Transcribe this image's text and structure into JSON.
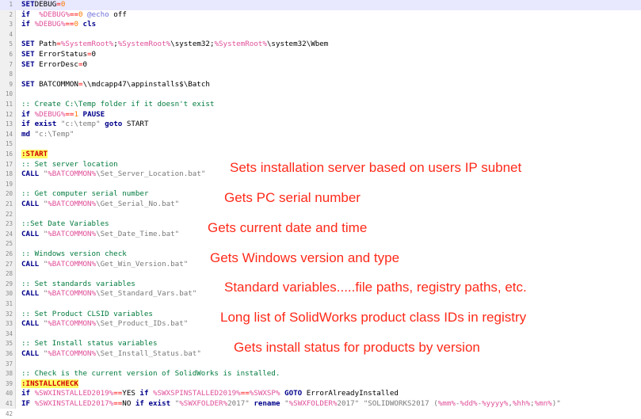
{
  "colors": {
    "keyword": "#00008b",
    "variable": "#e0509a",
    "operator": "#ff0000",
    "string": "#7a7a7a",
    "comment": "#007a3d",
    "number": "#ff7a00",
    "label_bg": "#ffff66",
    "annotation": "#ff2a1a"
  },
  "lines": [
    {
      "n": "1",
      "segs": [
        [
          "kw",
          "SET"
        ],
        [
          "",
          "DEBUG"
        ],
        [
          "op",
          "="
        ],
        [
          "num",
          "0"
        ]
      ]
    },
    {
      "n": "2",
      "segs": [
        [
          "kw",
          "if"
        ],
        [
          "",
          "  "
        ],
        [
          "var",
          "%DEBUG%"
        ],
        [
          "op",
          "=="
        ],
        [
          "num",
          "0"
        ],
        [
          "",
          ""
        ],
        [
          "cmd",
          " @echo"
        ],
        [
          "",
          " off"
        ]
      ]
    },
    {
      "n": "3",
      "segs": [
        [
          "kw",
          "if"
        ],
        [
          "",
          " "
        ],
        [
          "var",
          "%DEBUG%"
        ],
        [
          "op",
          "=="
        ],
        [
          "num",
          "0"
        ],
        [
          "",
          " "
        ],
        [
          "kw",
          "cls"
        ]
      ]
    },
    {
      "n": "4",
      "segs": []
    },
    {
      "n": "5",
      "segs": [
        [
          "kw",
          "SET"
        ],
        [
          "",
          " Path"
        ],
        [
          "op",
          "="
        ],
        [
          "var",
          "%SystemRoot%"
        ],
        [
          "",
          ";"
        ],
        [
          "var",
          "%SystemRoot%"
        ],
        [
          "",
          "\\system32;"
        ],
        [
          "var",
          "%SystemRoot%"
        ],
        [
          "",
          "\\system32\\Wbem"
        ]
      ]
    },
    {
      "n": "6",
      "segs": [
        [
          "kw",
          "SET"
        ],
        [
          "",
          " ErrorStatus"
        ],
        [
          "op",
          "="
        ],
        [
          "",
          "0"
        ]
      ]
    },
    {
      "n": "7",
      "segs": [
        [
          "kw",
          "SET"
        ],
        [
          "",
          " ErrorDesc"
        ],
        [
          "op",
          "="
        ],
        [
          "",
          "0"
        ]
      ]
    },
    {
      "n": "8",
      "segs": []
    },
    {
      "n": "9",
      "segs": [
        [
          "kw",
          "SET"
        ],
        [
          "",
          " BATCOMMON"
        ],
        [
          "op",
          "="
        ],
        [
          "",
          "\\\\mdcapp47\\appinstalls$\\Batch"
        ]
      ]
    },
    {
      "n": "10",
      "segs": []
    },
    {
      "n": "11",
      "segs": [
        [
          "cmt",
          ":: Create C:\\Temp folder if it doesn't exist"
        ]
      ]
    },
    {
      "n": "12",
      "segs": [
        [
          "kw",
          "if"
        ],
        [
          "",
          " "
        ],
        [
          "var",
          "%DEBUG%"
        ],
        [
          "op",
          "=="
        ],
        [
          "num",
          "1"
        ],
        [
          "",
          " "
        ],
        [
          "kw",
          "PAUSE"
        ]
      ]
    },
    {
      "n": "13",
      "segs": [
        [
          "kw",
          "if exist"
        ],
        [
          "",
          " "
        ],
        [
          "str",
          "\"c:\\temp\""
        ],
        [
          "",
          " "
        ],
        [
          "kw",
          "goto"
        ],
        [
          "",
          " START"
        ]
      ]
    },
    {
      "n": "14",
      "segs": [
        [
          "kw",
          "md"
        ],
        [
          "",
          " "
        ],
        [
          "str",
          "\"c:\\Temp\""
        ]
      ]
    },
    {
      "n": "15",
      "segs": []
    },
    {
      "n": "16",
      "segs": [
        [
          "lbl",
          ":START"
        ]
      ]
    },
    {
      "n": "17",
      "segs": [
        [
          "cmt",
          ":: Set server location"
        ]
      ]
    },
    {
      "n": "18",
      "segs": [
        [
          "kw",
          "CALL"
        ],
        [
          "",
          " "
        ],
        [
          "str",
          "\""
        ],
        [
          "var",
          "%BATCOMMON%"
        ],
        [
          "str",
          "\\Set_Server_Location.bat\""
        ]
      ]
    },
    {
      "n": "19",
      "segs": []
    },
    {
      "n": "20",
      "segs": [
        [
          "cmt",
          ":: Get computer serial number"
        ]
      ]
    },
    {
      "n": "21",
      "segs": [
        [
          "kw",
          "CALL"
        ],
        [
          "",
          " "
        ],
        [
          "str",
          "\""
        ],
        [
          "var",
          "%BATCOMMON%"
        ],
        [
          "str",
          "\\Get_Serial_No.bat\""
        ]
      ]
    },
    {
      "n": "22",
      "segs": []
    },
    {
      "n": "23",
      "segs": [
        [
          "cmt",
          "::Set Date Variables"
        ]
      ]
    },
    {
      "n": "24",
      "segs": [
        [
          "kw",
          "CALL"
        ],
        [
          "",
          " "
        ],
        [
          "str",
          "\""
        ],
        [
          "var",
          "%BATCOMMON%"
        ],
        [
          "str",
          "\\Set_Date_Time.bat\""
        ]
      ]
    },
    {
      "n": "25",
      "segs": []
    },
    {
      "n": "26",
      "segs": [
        [
          "cmt",
          ":: Windows version check"
        ]
      ]
    },
    {
      "n": "27",
      "segs": [
        [
          "kw",
          "CALL"
        ],
        [
          "",
          " "
        ],
        [
          "str",
          "\""
        ],
        [
          "var",
          "%BATCOMMON%"
        ],
        [
          "str",
          "\\Get_Win_Version.bat\""
        ]
      ]
    },
    {
      "n": "28",
      "segs": []
    },
    {
      "n": "29",
      "segs": [
        [
          "cmt",
          ":: Set standards variables"
        ]
      ]
    },
    {
      "n": "30",
      "segs": [
        [
          "kw",
          "CALL"
        ],
        [
          "",
          " "
        ],
        [
          "str",
          "\""
        ],
        [
          "var",
          "%BATCOMMON%"
        ],
        [
          "str",
          "\\Set_Standard_Vars.bat\""
        ]
      ]
    },
    {
      "n": "31",
      "segs": []
    },
    {
      "n": "32",
      "segs": [
        [
          "cmt",
          ":: Set Product CLSID variables"
        ]
      ]
    },
    {
      "n": "33",
      "segs": [
        [
          "kw",
          "CALL"
        ],
        [
          "",
          " "
        ],
        [
          "str",
          "\""
        ],
        [
          "var",
          "%BATCOMMON%"
        ],
        [
          "str",
          "\\Set_Product_IDs.bat\""
        ]
      ]
    },
    {
      "n": "34",
      "segs": []
    },
    {
      "n": "35",
      "segs": [
        [
          "cmt",
          ":: Set Install status variables"
        ]
      ]
    },
    {
      "n": "36",
      "segs": [
        [
          "kw",
          "CALL"
        ],
        [
          "",
          " "
        ],
        [
          "str",
          "\""
        ],
        [
          "var",
          "%BATCOMMON%"
        ],
        [
          "str",
          "\\Set_Install_Status.bat\""
        ]
      ]
    },
    {
      "n": "37",
      "segs": []
    },
    {
      "n": "38",
      "segs": [
        [
          "cmt",
          ":: Check is the current version of SolidWorks is installed."
        ]
      ]
    },
    {
      "n": "39",
      "segs": [
        [
          "lbl",
          ":INSTALLCHECK"
        ]
      ]
    },
    {
      "n": "40",
      "segs": [
        [
          "kw",
          "if"
        ],
        [
          "",
          " "
        ],
        [
          "var",
          "%SWXINSTALLED2019%"
        ],
        [
          "op",
          "=="
        ],
        [
          "",
          "YES "
        ],
        [
          "kw",
          "if"
        ],
        [
          "",
          " "
        ],
        [
          "var",
          "%SWXSPINSTALLED2019%"
        ],
        [
          "op",
          "=="
        ],
        [
          "var",
          "%SWXSP%"
        ],
        [
          "",
          " "
        ],
        [
          "kw",
          "GOTO"
        ],
        [
          "",
          " ErrorAlreadyInstalled"
        ]
      ]
    },
    {
      "n": "41",
      "segs": [
        [
          "kw",
          "IF"
        ],
        [
          "",
          " "
        ],
        [
          "var",
          "%SWXINSTALLED2017%"
        ],
        [
          "op",
          "=="
        ],
        [
          "",
          "NO "
        ],
        [
          "kw",
          "if exist"
        ],
        [
          "",
          " "
        ],
        [
          "str",
          "\""
        ],
        [
          "var",
          "%SWXFOLDER%"
        ],
        [
          "str",
          "2017\""
        ],
        [
          "",
          " "
        ],
        [
          "kw",
          "rename"
        ],
        [
          "",
          " "
        ],
        [
          "str",
          "\""
        ],
        [
          "var",
          "%SWXFOLDER%"
        ],
        [
          "str",
          "2017\""
        ],
        [
          "",
          " "
        ],
        [
          "str",
          "\"SOLIDWORKS2017 ("
        ],
        [
          "var",
          "%mm%"
        ],
        [
          "str",
          "-"
        ],
        [
          "var",
          "%dd%"
        ],
        [
          "str",
          "-"
        ],
        [
          "var",
          "%yyyy%"
        ],
        [
          "str",
          ","
        ],
        [
          "var",
          "%hh%"
        ],
        [
          "str",
          ";"
        ],
        [
          "var",
          "%mn%"
        ],
        [
          "str",
          ")\""
        ]
      ]
    },
    {
      "n": "42",
      "segs": []
    }
  ],
  "annotations": [
    {
      "line": 18,
      "text": "Sets installation server based on users IP subnet"
    },
    {
      "line": 21,
      "text": "Gets PC serial number"
    },
    {
      "line": 24,
      "text": "Gets current date and time"
    },
    {
      "line": 27,
      "text": "Gets Windows version and type"
    },
    {
      "line": 30,
      "text": "Standard variables.....file paths, registry paths, etc."
    },
    {
      "line": 33,
      "text": "Long list of SolidWorks product class IDs in registry"
    },
    {
      "line": 36,
      "text": "Gets install status for products by version"
    }
  ]
}
